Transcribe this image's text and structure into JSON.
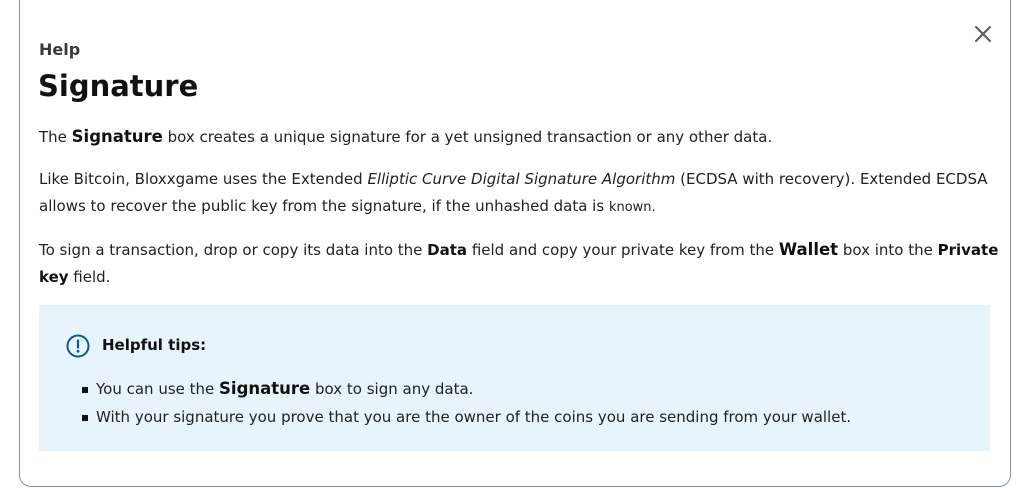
{
  "header": {
    "eyebrow": "Help",
    "title": "Signature",
    "close_icon": "close-icon"
  },
  "body": {
    "p1": {
      "pre": "The ",
      "strong": "Signature",
      "post": " box creates a unique signature for a yet unsigned transaction or any other data."
    },
    "p2": {
      "pre": "Like Bitcoin, Bloxxgame uses the Extended ",
      "em": "Elliptic Curve Digital Signature Algorithm",
      "post": " (ECDSA with recovery). Extended ECDSA allows to recover the public key from the signature, if the unhashed data is ",
      "last": "known."
    },
    "p3": {
      "pre": "To sign a transaction, drop or copy its data into the ",
      "data": "Data",
      "mid": " field and copy your private key from the ",
      "wallet": "Wallet",
      "mid2": " box into the ",
      "private_key": "Private key",
      "post": " field."
    }
  },
  "tips": {
    "icon": "info-circle-icon",
    "heading": "Helpful tips:",
    "item1": {
      "pre": "You can use the ",
      "strong": "Signature",
      "post": " box to sign any data."
    },
    "item2": "With your signature you prove that you are the owner of the coins you are sending from your wallet."
  },
  "colors": {
    "tips_background": "#e7f4fb",
    "tips_icon": "#0a5a8a",
    "text": "#222222",
    "border": "#8a9199"
  }
}
